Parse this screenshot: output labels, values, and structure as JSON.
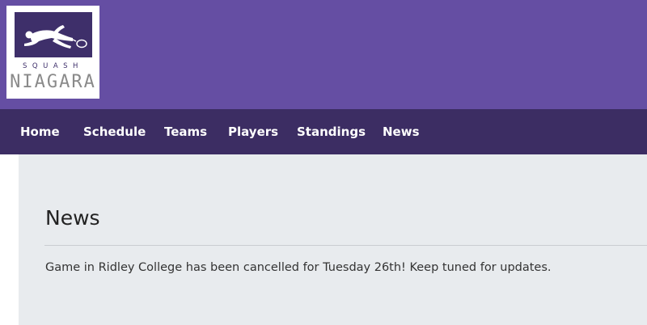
{
  "logo": {
    "line1": "SQUASH",
    "line2": "NIAGARA"
  },
  "nav": {
    "items": [
      "Home",
      "Schedule",
      "Teams",
      "Players",
      "Standings",
      "News"
    ]
  },
  "main": {
    "title": "News",
    "news_text": "Game in Ridley College has been cancelled for Tuesday 26th! Keep tuned for updates."
  },
  "colors": {
    "header_bg": "#654ea3",
    "nav_bg": "#3c2d63",
    "content_bg": "#e8ebee",
    "logo_panel": "#3e2f6a"
  }
}
